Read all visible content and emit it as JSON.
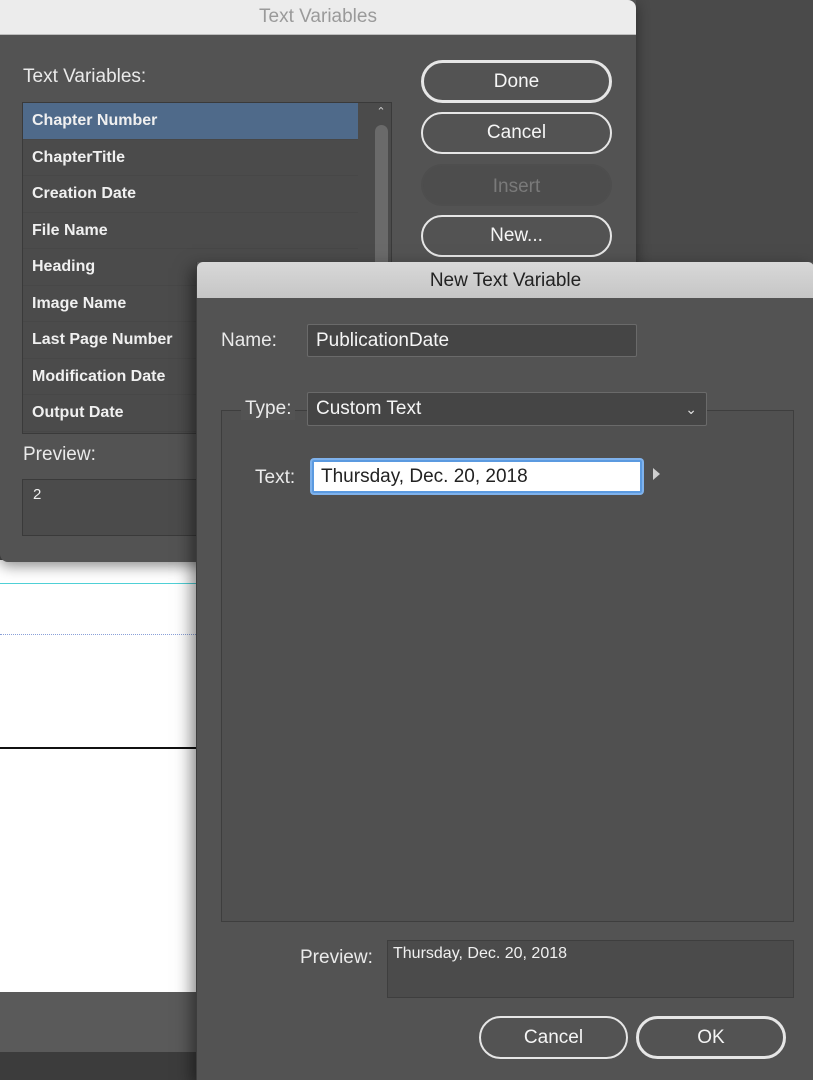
{
  "text_variables_dialog": {
    "title": "Text Variables",
    "list_label": "Text Variables:",
    "items": [
      {
        "label": "Chapter Number",
        "selected": true
      },
      {
        "label": "ChapterTitle",
        "selected": false
      },
      {
        "label": "Creation Date",
        "selected": false
      },
      {
        "label": "File Name",
        "selected": false
      },
      {
        "label": "Heading",
        "selected": false
      },
      {
        "label": "Image Name",
        "selected": false
      },
      {
        "label": "Last Page Number",
        "selected": false
      },
      {
        "label": "Modification Date",
        "selected": false
      },
      {
        "label": "Output Date",
        "selected": false
      }
    ],
    "preview_label": "Preview:",
    "preview_value": "2",
    "buttons": {
      "done": "Done",
      "cancel": "Cancel",
      "insert": "Insert",
      "new": "New..."
    }
  },
  "new_text_variable_dialog": {
    "title": "New Text Variable",
    "name_label": "Name:",
    "name_value": "PublicationDate",
    "type_label": "Type:",
    "type_value": "Custom Text",
    "text_label": "Text:",
    "text_value": "Thursday, Dec. 20, 2018",
    "preview_label": "Preview:",
    "preview_value": "Thursday, Dec. 20, 2018",
    "buttons": {
      "cancel": "Cancel",
      "ok": "OK"
    }
  },
  "colors": {
    "dialog_bg": "#535353",
    "selection": "#4f6a8a",
    "focus_ring": "#5b9ae0"
  }
}
